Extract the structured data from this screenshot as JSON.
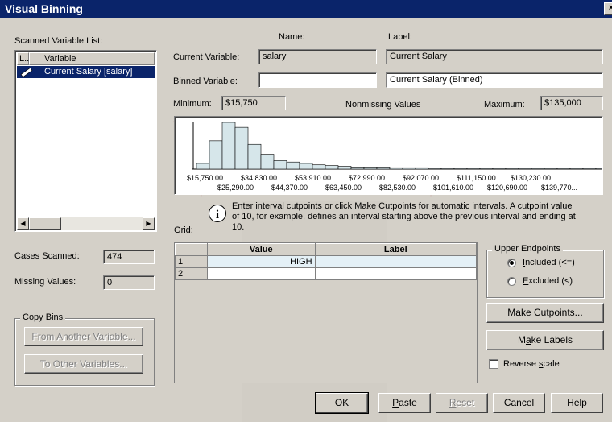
{
  "title": "Visual Binning",
  "close_glyph": "×",
  "left": {
    "scanned_label": "Scanned Variable List:",
    "col_short": "L...",
    "col_variable": "Variable",
    "variables": [
      "Current Salary [salary]"
    ],
    "cases_scanned_label": "Cases Scanned:",
    "cases_scanned_value": "474",
    "missing_label": "Missing Values:",
    "missing_value": "0",
    "copy_bins_label": "Copy Bins",
    "from_another_label": "From Another Variable...",
    "to_other_label": "To Other Variables..."
  },
  "top": {
    "name_header": "Name:",
    "label_header": "Label:",
    "current_variable_label": "Current Variable:",
    "current_variable_name": "salary",
    "current_variable_label_value": "Current Salary",
    "binned_variable_label": "Binned Variable:",
    "binned_variable_name": "",
    "binned_variable_label_value": "Current Salary (Binned)",
    "minimum_label": "Minimum:",
    "minimum_value": "$15,750",
    "nonmissing_label": "Nonmissing Values",
    "maximum_label": "Maximum:",
    "maximum_value": "$135,000"
  },
  "chart_data": {
    "type": "bar",
    "title": "",
    "tick_labels_top": [
      "$15,750.00",
      "$34,830.00",
      "$53,910.00",
      "$72,990.00",
      "$92,070.00",
      "$111,150.00",
      "$130,230.00"
    ],
    "tick_labels_bottom": [
      "$25,290.00",
      "$44,370.00",
      "$63,450.00",
      "$82,530.00",
      "$101,610.00",
      "$120,690.00",
      "$139,770..."
    ],
    "values": [
      8,
      40,
      66,
      59,
      35,
      21,
      12,
      10,
      8,
      6,
      5,
      4,
      3,
      3,
      3,
      2,
      2,
      2,
      1,
      1,
      1,
      1,
      1,
      1,
      1,
      1,
      1,
      1,
      1,
      1,
      1,
      1,
      1
    ]
  },
  "info_text_line1": "Enter interval cutpoints or click Make Cutpoints for automatic intervals.  A cutpoint value",
  "info_text_line2": "of 10, for example, defines an interval starting above the previous interval and ending at",
  "info_text_line3": "10.",
  "grid": {
    "label": "Grid:",
    "columns": [
      "Value",
      "Label"
    ],
    "rows": [
      {
        "num": "1",
        "value": "HIGH",
        "label": ""
      },
      {
        "num": "2",
        "value": "",
        "label": ""
      }
    ]
  },
  "upper": {
    "group_label": "Upper Endpoints",
    "included_label": "Included (<=)",
    "excluded_label": "Excluded (<)"
  },
  "buttons": {
    "make_cutpoints": "Make Cutpoints...",
    "make_labels": "Make Labels",
    "reverse_scale": "Reverse scale",
    "ok": "OK",
    "paste": "Paste",
    "reset": "Reset",
    "cancel": "Cancel",
    "help": "Help"
  },
  "colors": {
    "titlebar": "#0a246a",
    "face": "#d4d0c8",
    "bar_fill": "#d6e6ea",
    "grid_row": "#e4f0f6"
  }
}
